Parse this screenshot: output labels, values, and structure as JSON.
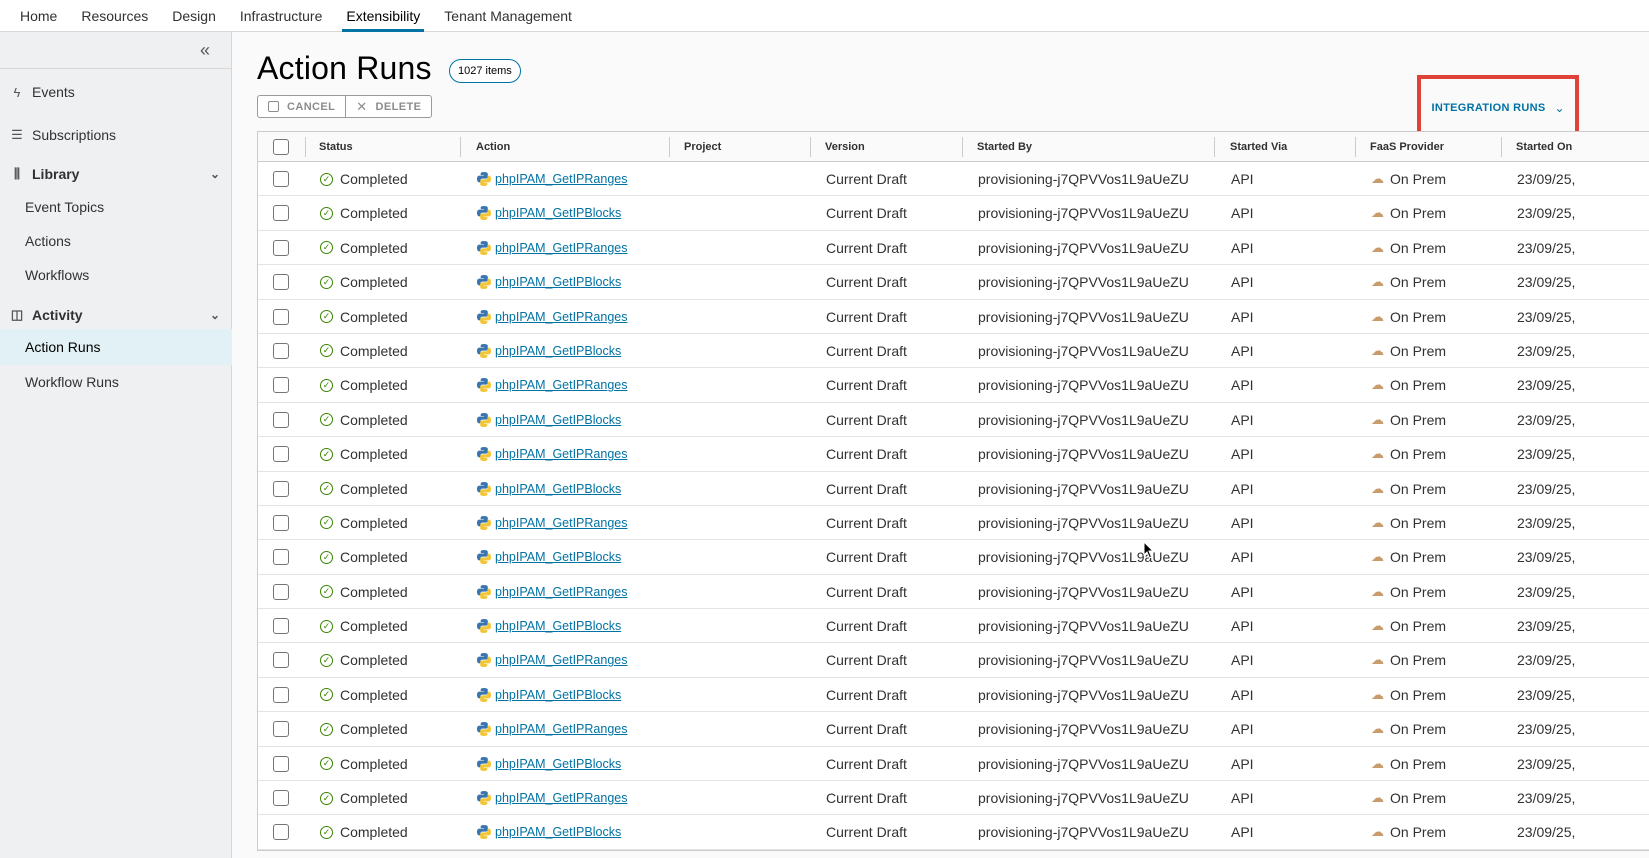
{
  "nav": {
    "tabs": [
      {
        "label": "Home"
      },
      {
        "label": "Resources"
      },
      {
        "label": "Design"
      },
      {
        "label": "Infrastructure"
      },
      {
        "label": "Extensibility",
        "active": true
      },
      {
        "label": "Tenant Management"
      }
    ]
  },
  "sidebar": {
    "collapse_icon": "double-chevron-left-icon",
    "events": "Events",
    "subscriptions": "Subscriptions",
    "library": "Library",
    "event_topics": "Event Topics",
    "actions": "Actions",
    "workflows": "Workflows",
    "activity": "Activity",
    "action_runs": "Action Runs",
    "workflow_runs": "Workflow Runs"
  },
  "page": {
    "title": "Action Runs",
    "count": "1027 items",
    "cancel_label": "CANCEL",
    "delete_label": "DELETE",
    "integration_runs_label": "INTEGRATION RUNS"
  },
  "colors": {
    "accent": "#0072a3",
    "highlight_border": "#e0423a",
    "status_ok": "#3c8500"
  },
  "table": {
    "columns": {
      "status": "Status",
      "action": "Action",
      "project": "Project",
      "version": "Version",
      "started_by": "Started By",
      "started_via": "Started Via",
      "faas": "FaaS Provider",
      "started_on": "Started On"
    },
    "rows": [
      {
        "status": "Completed",
        "action": "phpIPAM_GetIPRanges",
        "project": "",
        "version": "Current Draft",
        "started_by": "provisioning-j7QPVVos1L9aUeZU",
        "started_via": "API",
        "faas": "On Prem",
        "started_on": "23/09/25,"
      },
      {
        "status": "Completed",
        "action": "phpIPAM_GetIPBlocks",
        "project": "",
        "version": "Current Draft",
        "started_by": "provisioning-j7QPVVos1L9aUeZU",
        "started_via": "API",
        "faas": "On Prem",
        "started_on": "23/09/25,"
      },
      {
        "status": "Completed",
        "action": "phpIPAM_GetIPRanges",
        "project": "",
        "version": "Current Draft",
        "started_by": "provisioning-j7QPVVos1L9aUeZU",
        "started_via": "API",
        "faas": "On Prem",
        "started_on": "23/09/25,"
      },
      {
        "status": "Completed",
        "action": "phpIPAM_GetIPBlocks",
        "project": "",
        "version": "Current Draft",
        "started_by": "provisioning-j7QPVVos1L9aUeZU",
        "started_via": "API",
        "faas": "On Prem",
        "started_on": "23/09/25,"
      },
      {
        "status": "Completed",
        "action": "phpIPAM_GetIPRanges",
        "project": "",
        "version": "Current Draft",
        "started_by": "provisioning-j7QPVVos1L9aUeZU",
        "started_via": "API",
        "faas": "On Prem",
        "started_on": "23/09/25,"
      },
      {
        "status": "Completed",
        "action": "phpIPAM_GetIPBlocks",
        "project": "",
        "version": "Current Draft",
        "started_by": "provisioning-j7QPVVos1L9aUeZU",
        "started_via": "API",
        "faas": "On Prem",
        "started_on": "23/09/25,"
      },
      {
        "status": "Completed",
        "action": "phpIPAM_GetIPRanges",
        "project": "",
        "version": "Current Draft",
        "started_by": "provisioning-j7QPVVos1L9aUeZU",
        "started_via": "API",
        "faas": "On Prem",
        "started_on": "23/09/25,"
      },
      {
        "status": "Completed",
        "action": "phpIPAM_GetIPBlocks",
        "project": "",
        "version": "Current Draft",
        "started_by": "provisioning-j7QPVVos1L9aUeZU",
        "started_via": "API",
        "faas": "On Prem",
        "started_on": "23/09/25,"
      },
      {
        "status": "Completed",
        "action": "phpIPAM_GetIPRanges",
        "project": "",
        "version": "Current Draft",
        "started_by": "provisioning-j7QPVVos1L9aUeZU",
        "started_via": "API",
        "faas": "On Prem",
        "started_on": "23/09/25,"
      },
      {
        "status": "Completed",
        "action": "phpIPAM_GetIPBlocks",
        "project": "",
        "version": "Current Draft",
        "started_by": "provisioning-j7QPVVos1L9aUeZU",
        "started_via": "API",
        "faas": "On Prem",
        "started_on": "23/09/25,"
      },
      {
        "status": "Completed",
        "action": "phpIPAM_GetIPRanges",
        "project": "",
        "version": "Current Draft",
        "started_by": "provisioning-j7QPVVos1L9aUeZU",
        "started_via": "API",
        "faas": "On Prem",
        "started_on": "23/09/25,"
      },
      {
        "status": "Completed",
        "action": "phpIPAM_GetIPBlocks",
        "project": "",
        "version": "Current Draft",
        "started_by": "provisioning-j7QPVVos1L9aUeZU",
        "started_via": "API",
        "faas": "On Prem",
        "started_on": "23/09/25,"
      },
      {
        "status": "Completed",
        "action": "phpIPAM_GetIPRanges",
        "project": "",
        "version": "Current Draft",
        "started_by": "provisioning-j7QPVVos1L9aUeZU",
        "started_via": "API",
        "faas": "On Prem",
        "started_on": "23/09/25,"
      },
      {
        "status": "Completed",
        "action": "phpIPAM_GetIPBlocks",
        "project": "",
        "version": "Current Draft",
        "started_by": "provisioning-j7QPVVos1L9aUeZU",
        "started_via": "API",
        "faas": "On Prem",
        "started_on": "23/09/25,"
      },
      {
        "status": "Completed",
        "action": "phpIPAM_GetIPRanges",
        "project": "",
        "version": "Current Draft",
        "started_by": "provisioning-j7QPVVos1L9aUeZU",
        "started_via": "API",
        "faas": "On Prem",
        "started_on": "23/09/25,"
      },
      {
        "status": "Completed",
        "action": "phpIPAM_GetIPBlocks",
        "project": "",
        "version": "Current Draft",
        "started_by": "provisioning-j7QPVVos1L9aUeZU",
        "started_via": "API",
        "faas": "On Prem",
        "started_on": "23/09/25,"
      },
      {
        "status": "Completed",
        "action": "phpIPAM_GetIPRanges",
        "project": "",
        "version": "Current Draft",
        "started_by": "provisioning-j7QPVVos1L9aUeZU",
        "started_via": "API",
        "faas": "On Prem",
        "started_on": "23/09/25,"
      },
      {
        "status": "Completed",
        "action": "phpIPAM_GetIPBlocks",
        "project": "",
        "version": "Current Draft",
        "started_by": "provisioning-j7QPVVos1L9aUeZU",
        "started_via": "API",
        "faas": "On Prem",
        "started_on": "23/09/25,"
      },
      {
        "status": "Completed",
        "action": "phpIPAM_GetIPRanges",
        "project": "",
        "version": "Current Draft",
        "started_by": "provisioning-j7QPVVos1L9aUeZU",
        "started_via": "API",
        "faas": "On Prem",
        "started_on": "23/09/25,"
      },
      {
        "status": "Completed",
        "action": "phpIPAM_GetIPBlocks",
        "project": "",
        "version": "Current Draft",
        "started_by": "provisioning-j7QPVVos1L9aUeZU",
        "started_via": "API",
        "faas": "On Prem",
        "started_on": "23/09/25,"
      }
    ]
  }
}
